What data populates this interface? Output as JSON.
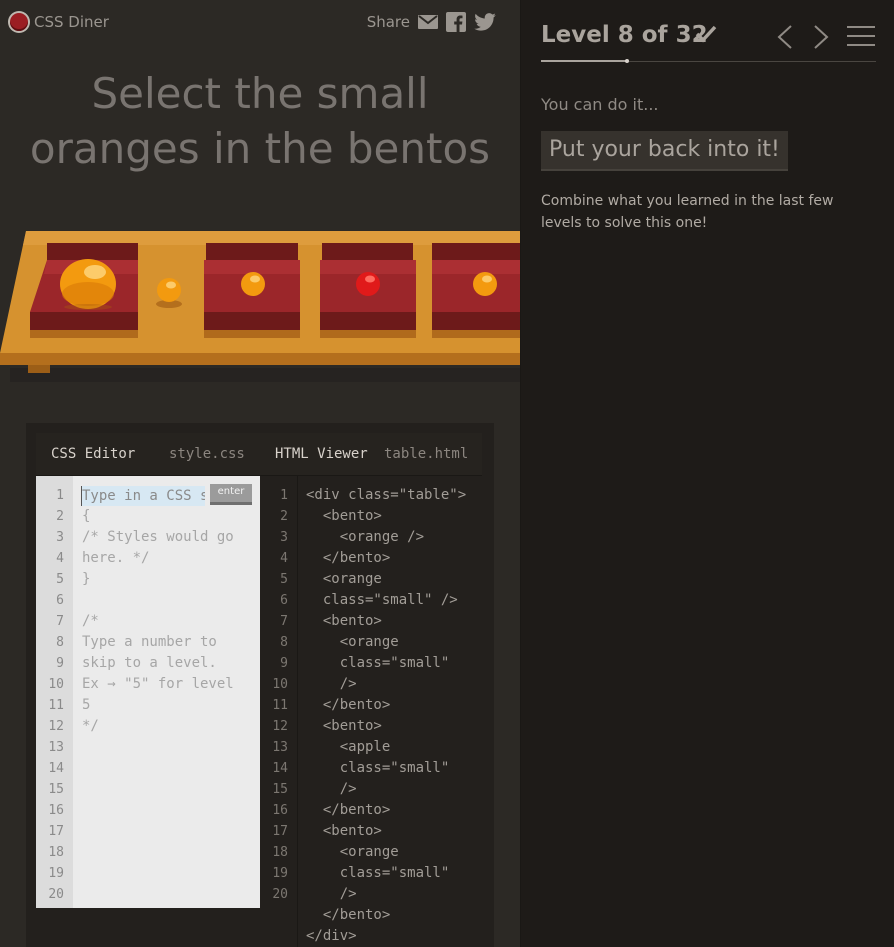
{
  "header": {
    "logo_text": "CSS Diner",
    "share_label": "Share",
    "share_icons": [
      "email-icon",
      "facebook-icon",
      "twitter-icon"
    ]
  },
  "instruction": "Select the small oranges in the bentos",
  "instruction_lines": [
    "Select the small",
    "oranges in the bentos"
  ],
  "editor": {
    "css_title": "CSS Editor",
    "css_file": "style.css",
    "html_title": "HTML Viewer",
    "html_file": "table.html",
    "input_placeholder": "Type in a CSS selector",
    "enter_label": "enter",
    "css_lines": [
      "",
      "{",
      "/* Styles would go",
      "here. */",
      "}",
      "",
      "/*",
      "Type a number to",
      "skip to a level.",
      "Ex → \"5\" for level",
      "5",
      "*/"
    ],
    "css_line_numbers": [
      "1",
      "2",
      "3",
      "4",
      "5",
      "6",
      "7",
      "8",
      "9",
      "10",
      "11",
      "12",
      "13",
      "14",
      "15",
      "16",
      "17",
      "18",
      "19",
      "20"
    ],
    "html_lines": [
      "<div class=\"table\">",
      "  <bento>",
      "    <orange />",
      "  </bento>",
      "  <orange",
      "  class=\"small\" />",
      "  <bento>",
      "    <orange",
      "    class=\"small\"",
      "    />",
      "  </bento>",
      "  <bento>",
      "    <apple",
      "    class=\"small\"",
      "    />",
      "  </bento>",
      "  <bento>",
      "    <orange",
      "    class=\"small\"",
      "    />",
      "  </bento>",
      "</div>"
    ],
    "html_line_numbers": [
      "1",
      "2",
      "3",
      "4",
      "5",
      "6",
      "7",
      "8",
      "9",
      "10",
      "11",
      "12",
      "13",
      "14",
      "15",
      "16",
      "17",
      "18",
      "19",
      "20"
    ]
  },
  "sidebar": {
    "level_text": "Level 8 of 32",
    "level_current": 8,
    "level_total": 32,
    "subhead": "You can do it...",
    "display_text": "Put your back into it!",
    "description": "Combine what you learned in the last few levels to solve this one!"
  },
  "colors": {
    "table": "#d6922f",
    "bento": "#9b262a",
    "orange": "#f39a0f",
    "apple": "#e01a1a",
    "left_bg": "#2c2925",
    "right_bg": "#1e1b18"
  }
}
